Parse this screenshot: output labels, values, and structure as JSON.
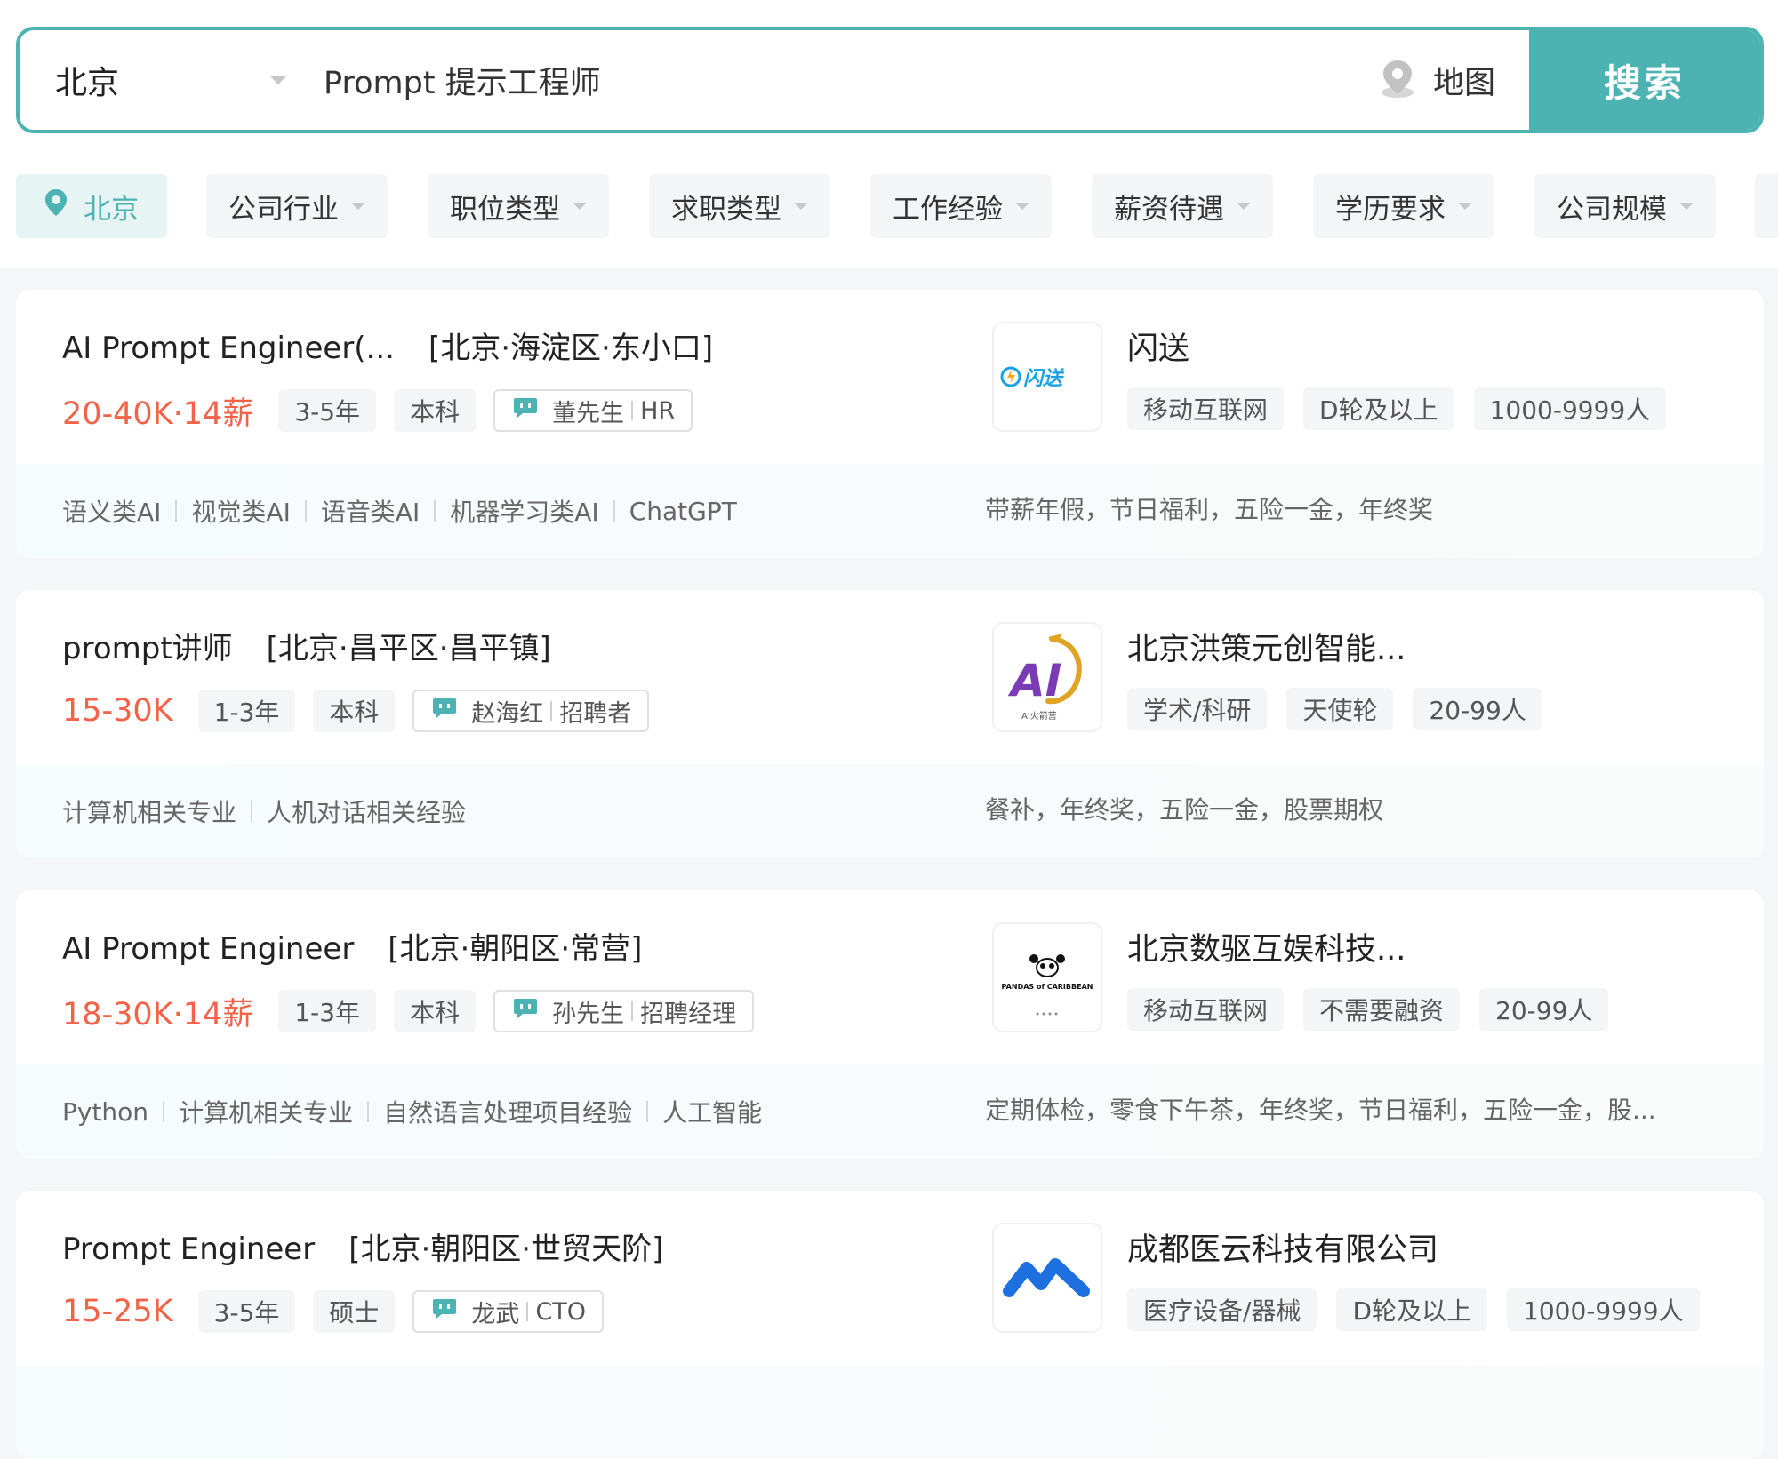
{
  "search": {
    "city": "北京",
    "query": "Prompt 提示工程师",
    "map_label": "地图",
    "button_label": "搜索"
  },
  "filters": {
    "city": "北京",
    "items": [
      "公司行业",
      "职位类型",
      "求职类型",
      "工作经验",
      "薪资待遇",
      "学历要求",
      "公司规模"
    ]
  },
  "jobs": [
    {
      "title": "AI Prompt Engineer(...",
      "area": "[北京·海淀区·东小口]",
      "salary": "20-40K·14薪",
      "experience": "3-5年",
      "education": "本科",
      "recruiter_name": "董先生",
      "recruiter_role": "HR",
      "company": "闪送",
      "company_tags": [
        "移动互联网",
        "D轮及以上",
        "1000-9999人"
      ],
      "skills": [
        "语义类AI",
        "视觉类AI",
        "语音类AI",
        "机器学习类AI",
        "ChatGPT"
      ],
      "benefits": "带薪年假，节日福利，五险一金，年终奖",
      "logo_text": "闪送"
    },
    {
      "title": "prompt讲师",
      "area": "[北京·昌平区·昌平镇]",
      "salary": "15-30K",
      "experience": "1-3年",
      "education": "本科",
      "recruiter_name": "赵海红",
      "recruiter_role": "招聘者",
      "company": "北京洪策元创智能...",
      "company_tags": [
        "学术/科研",
        "天使轮",
        "20-99人"
      ],
      "skills": [
        "计算机相关专业",
        "人机对话相关经验"
      ],
      "benefits": "餐补，年终奖，五险一金，股票期权",
      "logo_text": "AI",
      "logo_subtext": "AI火箭营"
    },
    {
      "title": "AI Prompt Engineer",
      "area": "[北京·朝阳区·常营]",
      "salary": "18-30K·14薪",
      "experience": "1-3年",
      "education": "本科",
      "recruiter_name": "孙先生",
      "recruiter_role": "招聘经理",
      "company": "北京数驱互娱科技...",
      "company_tags": [
        "移动互联网",
        "不需要融资",
        "20-99人"
      ],
      "skills": [
        "Python",
        "计算机相关专业",
        "自然语言处理项目经验",
        "人工智能"
      ],
      "benefits": "定期体检，零食下午茶，年终奖，节日福利，五险一金，股...",
      "logo_text": "PANDAS of CARIBBEAN"
    },
    {
      "title": "Prompt Engineer",
      "area": "[北京·朝阳区·世贸天阶]",
      "salary": "15-25K",
      "experience": "3-5年",
      "education": "硕士",
      "recruiter_name": "龙武",
      "recruiter_role": "CTO",
      "company": "成都医云科技有限公司",
      "company_tags": [
        "医疗设备/器械",
        "D轮及以上",
        "1000-9999人"
      ],
      "skills": [],
      "benefits": ""
    }
  ],
  "colors": {
    "accent": "#4db2b2",
    "salary": "#f2634a",
    "page_bg": "#f5f6f7",
    "tag_bg": "#f3f5f7"
  }
}
